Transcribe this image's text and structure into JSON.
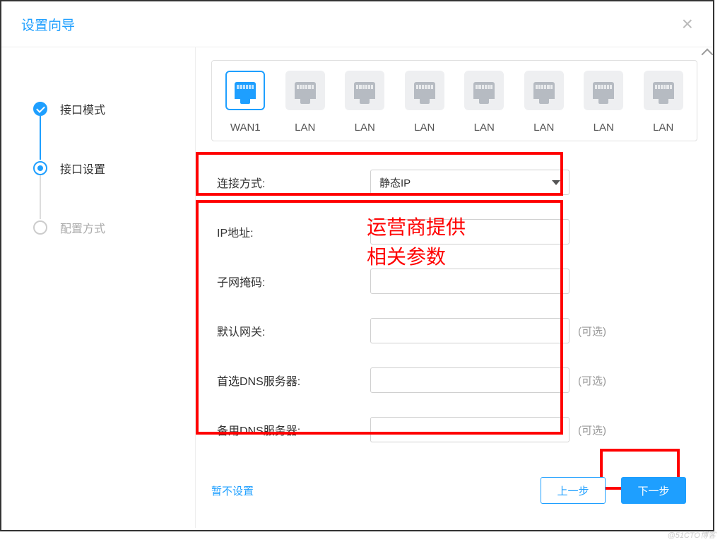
{
  "modal": {
    "title": "设置向导"
  },
  "steps": [
    {
      "label": "接口模式",
      "state": "done"
    },
    {
      "label": "接口设置",
      "state": "active"
    },
    {
      "label": "配置方式",
      "state": "pending"
    }
  ],
  "ports": {
    "items": [
      {
        "label": "WAN1",
        "selected": true
      },
      {
        "label": "LAN",
        "selected": false
      },
      {
        "label": "LAN",
        "selected": false
      },
      {
        "label": "LAN",
        "selected": false
      },
      {
        "label": "LAN",
        "selected": false
      },
      {
        "label": "LAN",
        "selected": false
      },
      {
        "label": "LAN",
        "selected": false
      },
      {
        "label": "LAN",
        "selected": false
      }
    ]
  },
  "form": {
    "connection_label": "连接方式:",
    "connection_value": "静态IP",
    "ip_label": "IP地址:",
    "ip_value": "",
    "mask_label": "子网掩码:",
    "mask_value": "",
    "gateway_label": "默认网关:",
    "gateway_value": "",
    "dns1_label": "首选DNS服务器:",
    "dns1_value": "",
    "dns2_label": "备用DNS服务器:",
    "dns2_value": "",
    "optional_text": "(可选)"
  },
  "annotation": {
    "line1": "运营商提供",
    "line2": "相关参数"
  },
  "footer": {
    "skip": "暂不设置",
    "prev": "上一步",
    "next": "下一步"
  },
  "watermark": "@51CTO博客"
}
